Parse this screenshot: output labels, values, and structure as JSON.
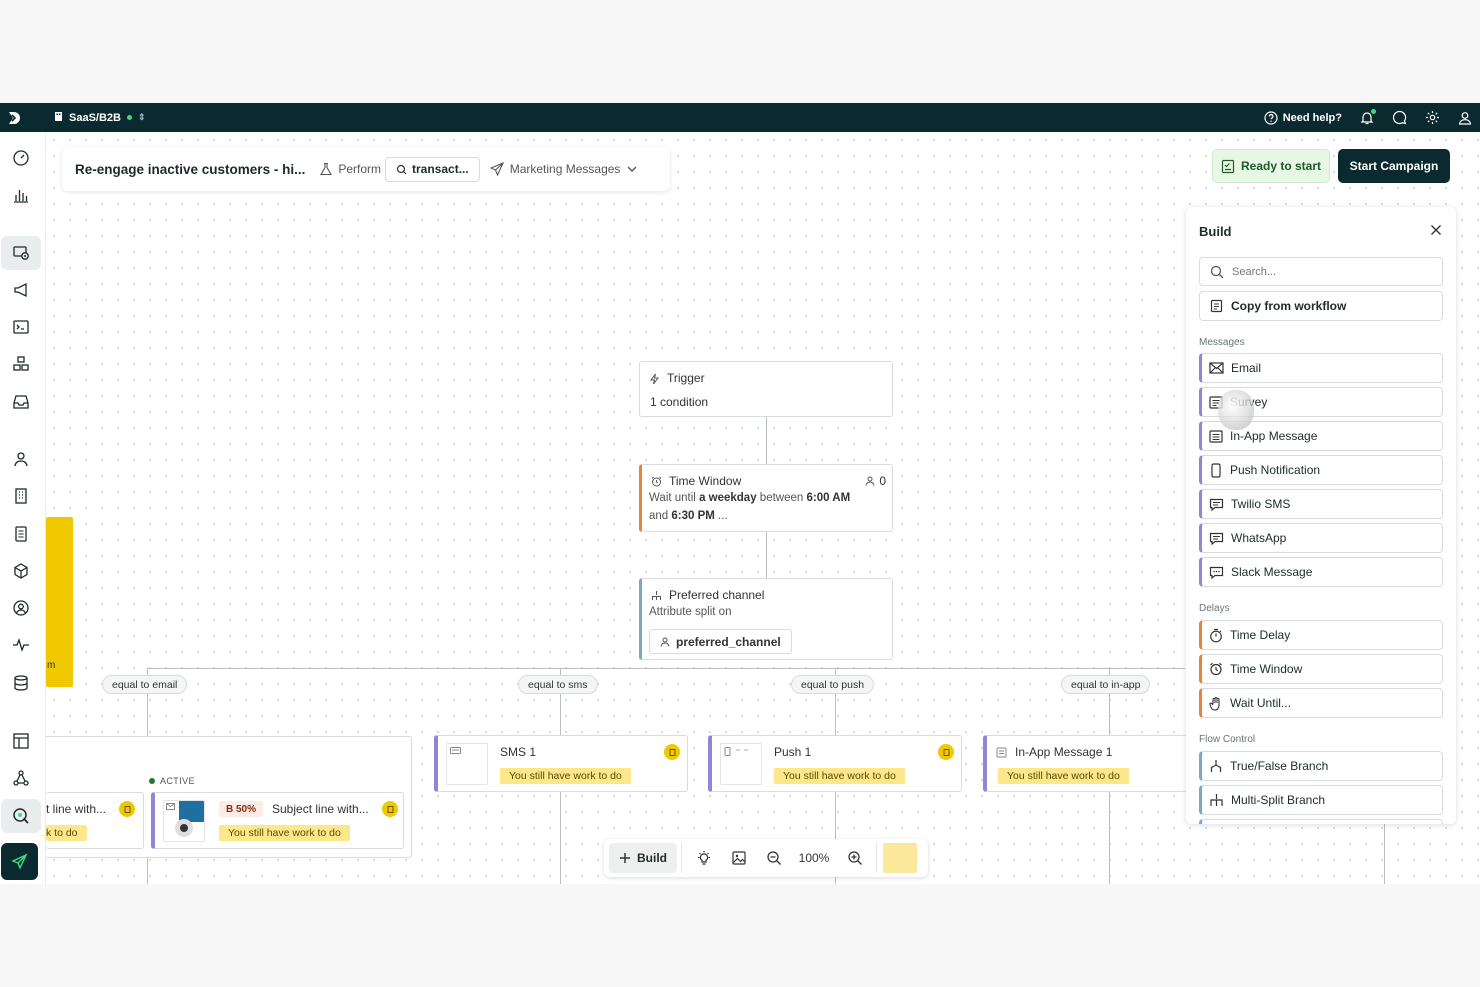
{
  "topbar": {
    "workspace": "SaaS/B2B",
    "help": "Need help?"
  },
  "header": {
    "title": "Re-engage inactive customers - hi...",
    "goal_label": "Perform",
    "goal_value": "transact...",
    "subscription": "Marketing Messages"
  },
  "actions": {
    "ready": "Ready to start",
    "start": "Start Campaign"
  },
  "build_panel": {
    "title": "Build",
    "search_placeholder": "Search...",
    "copy": "Copy from workflow",
    "sections": {
      "messages": "Messages",
      "delays": "Delays",
      "flow_control": "Flow Control"
    },
    "messages": [
      "Email",
      "Survey",
      "In-App Message",
      "Push Notification",
      "Twilio SMS",
      "WhatsApp",
      "Slack Message"
    ],
    "delays": [
      "Time Delay",
      "Time Window",
      "Wait Until..."
    ],
    "flow_control": [
      "True/False Branch",
      "Multi-Split Branch"
    ]
  },
  "flow": {
    "trigger": {
      "title": "Trigger",
      "detail": "1 condition"
    },
    "time_window": {
      "title": "Time Window",
      "count": "0",
      "line1_pre": "Wait until ",
      "line1_bold": "a weekday",
      "line1_mid": " between ",
      "line1_time": "6:00 AM",
      "line2_pre": "and ",
      "line2_time": "6:30 PM",
      "line2_post": " ..."
    },
    "split": {
      "title": "Preferred channel",
      "subtitle": "Attribute split on",
      "attribute": "preferred_channel"
    },
    "branches": [
      "equal to email",
      "equal to sms",
      "equal to push",
      "equal to in-app"
    ],
    "nodes": {
      "email_partial": {
        "subject": "t line with...",
        "warning": "k to do"
      },
      "email_active": {
        "status": "ACTIVE",
        "ab": "B 50%",
        "subject": "Subject line with...",
        "warning": "You still have work to do"
      },
      "sms": {
        "title": "SMS 1",
        "warning": "You still have work to do"
      },
      "push": {
        "title": "Push 1",
        "warning": "You still have work to do"
      },
      "inapp": {
        "title": "In-App Message 1",
        "warning": "You still have work to do"
      }
    },
    "sticky_text": "m"
  },
  "toolbar": {
    "build": "Build",
    "zoom": "100%"
  },
  "colors": {
    "topbar": "#0b2a30",
    "delay_accent": "#e8843a",
    "message_accent": "#8f86d6",
    "warning": "#fce88a",
    "ready_bg": "#e6f7e4"
  }
}
